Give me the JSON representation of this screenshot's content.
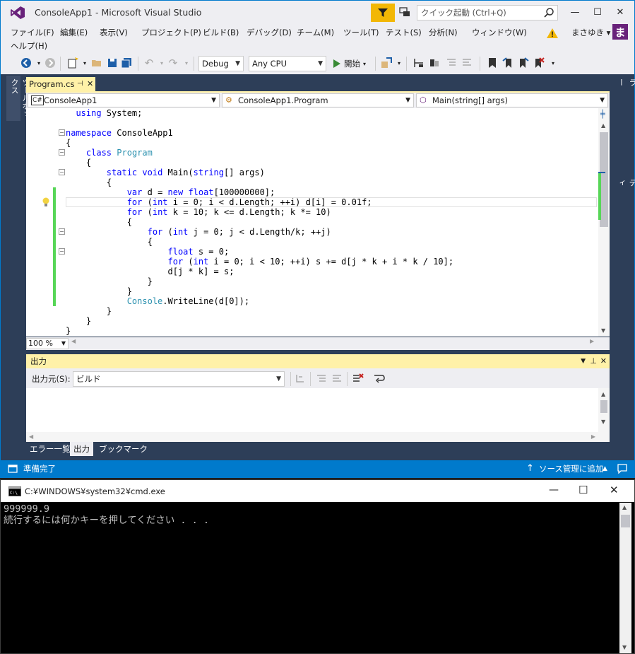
{
  "window": {
    "title": "ConsoleApp1 - Microsoft Visual Studio",
    "quick_launch_placeholder": "クイック起動 (Ctrl+Q)",
    "minimize": "—",
    "maximize": "☐",
    "close": "✕"
  },
  "menu": {
    "items": [
      "ファイル(F)",
      "編集(E)",
      "表示(V)",
      "プロジェクト(P)",
      "ビルド(B)",
      "デバッグ(D)",
      "チーム(M)",
      "ツール(T)",
      "テスト(S)",
      "分析(N)",
      "ウィンドウ(W)"
    ],
    "help": "ヘルプ(H)",
    "user": "まさゆき",
    "avatar": "ま"
  },
  "toolbar": {
    "config": "Debug",
    "platform": "Any CPU",
    "start_label": "開始"
  },
  "toolbox_label": "ツールボックス",
  "right_panels": {
    "solution_explorer": "ソリューション エクスプローラー",
    "properties": "プロパティ"
  },
  "editor": {
    "tab_label": "Program.cs",
    "nav_project": "ConsoleApp1",
    "nav_class": "ConsoleApp1.Program",
    "nav_member": "Main(string[] args)",
    "zoom": "100 %"
  },
  "output": {
    "title": "出力",
    "source_label": "出力元(S):",
    "source_value": "ビルド"
  },
  "bottom_tabs": [
    "エラー一覧",
    "出力",
    "ブックマーク"
  ],
  "status": {
    "ready": "準備完了",
    "source_control": "ソース管理に追加"
  },
  "cmd": {
    "title": "C:¥WINDOWS¥system32¥cmd.exe",
    "line1": "999999.9",
    "line2": "続行するには何かキーを押してください . . ."
  },
  "colors": {
    "accent": "#007acc",
    "filter_yellow": "#f2b705",
    "tab_yellow": "#fff1a8",
    "avatar_purple": "#68217a"
  }
}
